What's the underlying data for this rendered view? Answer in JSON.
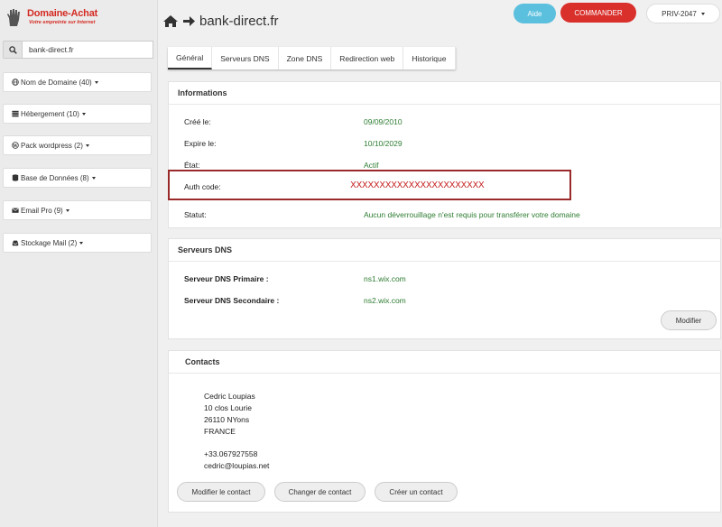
{
  "brand": {
    "title": "Domaine-Achat",
    "subtitle": "Votre empreinte sur Internet",
    "color": "#d42a22"
  },
  "search": {
    "value": "bank-direct.fr",
    "icon": "search-icon"
  },
  "sidebar": {
    "items": [
      {
        "label": "Nom de Domaine (40)",
        "icon": "globe-icon"
      },
      {
        "label": "Hébergement (10)",
        "icon": "server-icon"
      },
      {
        "label": "Pack wordpress (2)",
        "icon": "wordpress-icon"
      },
      {
        "label": "Base de Données (8)",
        "icon": "database-icon"
      },
      {
        "label": "Email Pro (9)",
        "icon": "envelope-icon"
      },
      {
        "label": "Stockage Mail (2)",
        "icon": "inbox-icon"
      }
    ]
  },
  "header": {
    "title": "bank-direct.fr",
    "aide_label": "Aide",
    "commander_label": "COMMANDER",
    "account_label": "PRIV-2047",
    "aide_color": "#5bc0de",
    "commander_color": "#d9302c"
  },
  "tabs": [
    {
      "label": "Général",
      "active": true
    },
    {
      "label": "Serveurs DNS",
      "active": false
    },
    {
      "label": "Zone DNS",
      "active": false
    },
    {
      "label": "Redirection web",
      "active": false
    },
    {
      "label": "Historique",
      "active": false
    }
  ],
  "informations": {
    "heading": "Informations",
    "created_label": "Créé le:",
    "created_value": "09/09/2010",
    "expires_label": "Expire le:",
    "expires_value": "10/10/2029",
    "state_label": "État:",
    "state_value": "Actif",
    "auth_label": "Auth code:",
    "auth_value": "XXXXXXXXXXXXXXXXXXXXXXX",
    "status_label": "Statut:",
    "status_value": "Aucun déverrouillage n'est requis pour transférer votre domaine"
  },
  "dns": {
    "heading": "Serveurs DNS",
    "primary_label": "Serveur DNS Primaire :",
    "primary_value": "ns1.wix.com",
    "secondary_label": "Serveur DNS Secondaire :",
    "secondary_value": "ns2.wix.com",
    "modify_label": "Modifier"
  },
  "contacts": {
    "heading": "Contacts",
    "name": "Cedric Loupias",
    "address1": "10 clos Lourie",
    "address2": "26110 NYons",
    "country": "FRANCE",
    "phone": "+33.067927558",
    "email": "cedric@loupias.net",
    "modify_label": "Modifier le contact",
    "change_label": "Changer de contact",
    "create_label": "Créer un contact"
  }
}
